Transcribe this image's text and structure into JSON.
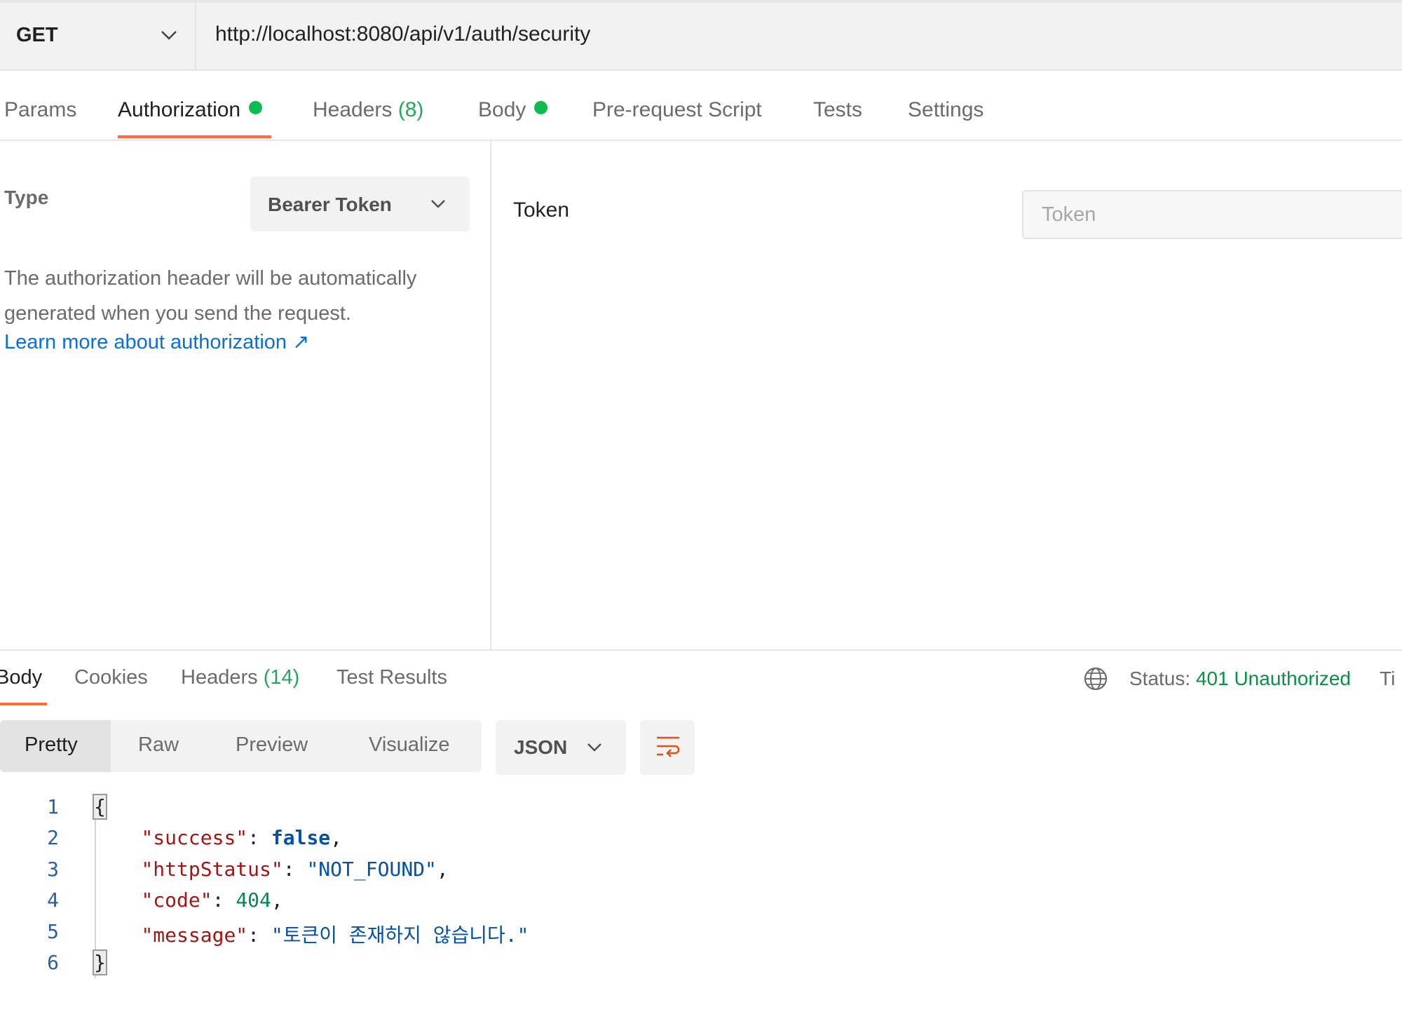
{
  "request": {
    "method": "GET",
    "url": "http://localhost:8080/api/v1/auth/security"
  },
  "tabs": {
    "params": "Params",
    "authorization": "Authorization",
    "headers": "Headers",
    "headers_count": "(8)",
    "body": "Body",
    "prerequest": "Pre-request Script",
    "tests": "Tests",
    "settings": "Settings"
  },
  "auth": {
    "type_label": "Type",
    "type_value": "Bearer Token",
    "description": "The authorization header will be automatically generated when you send the request.",
    "learn_more": "Learn more about authorization ↗",
    "token_label": "Token",
    "token_placeholder": "Token",
    "token_value": ""
  },
  "response": {
    "tabs": {
      "body": "Body",
      "cookies": "Cookies",
      "headers": "Headers",
      "headers_count": "(14)",
      "test_results": "Test Results"
    },
    "status_label": "Status:",
    "status_value": "401 Unauthorized",
    "time_label_cut": "Ti",
    "format": {
      "pretty": "Pretty",
      "raw": "Raw",
      "preview": "Preview",
      "visualize": "Visualize"
    },
    "language": "JSON",
    "line_numbers": [
      "1",
      "2",
      "3",
      "4",
      "5",
      "6"
    ],
    "json": {
      "open": "{",
      "success_key": "\"success\"",
      "success_val": "false",
      "httpStatus_key": "\"httpStatus\"",
      "httpStatus_val": "\"NOT_FOUND\"",
      "code_key": "\"code\"",
      "code_val": "404",
      "message_key": "\"message\"",
      "message_val": "\"토큰이 존재하지 않습니다.\"",
      "close": "}"
    }
  },
  "colors": {
    "accent": "#ff6c37",
    "status_success": "#0cbb52",
    "link": "#0b6fd6",
    "status_text": "#0a8f45"
  },
  "icons": {
    "method_dropdown": "chevron-down-icon",
    "type_dropdown": "chevron-down-icon",
    "link_external": "arrow-up-right",
    "network": "globe-icon",
    "language_dropdown": "chevron-down-icon",
    "wrap": "wrap-lines-icon"
  }
}
